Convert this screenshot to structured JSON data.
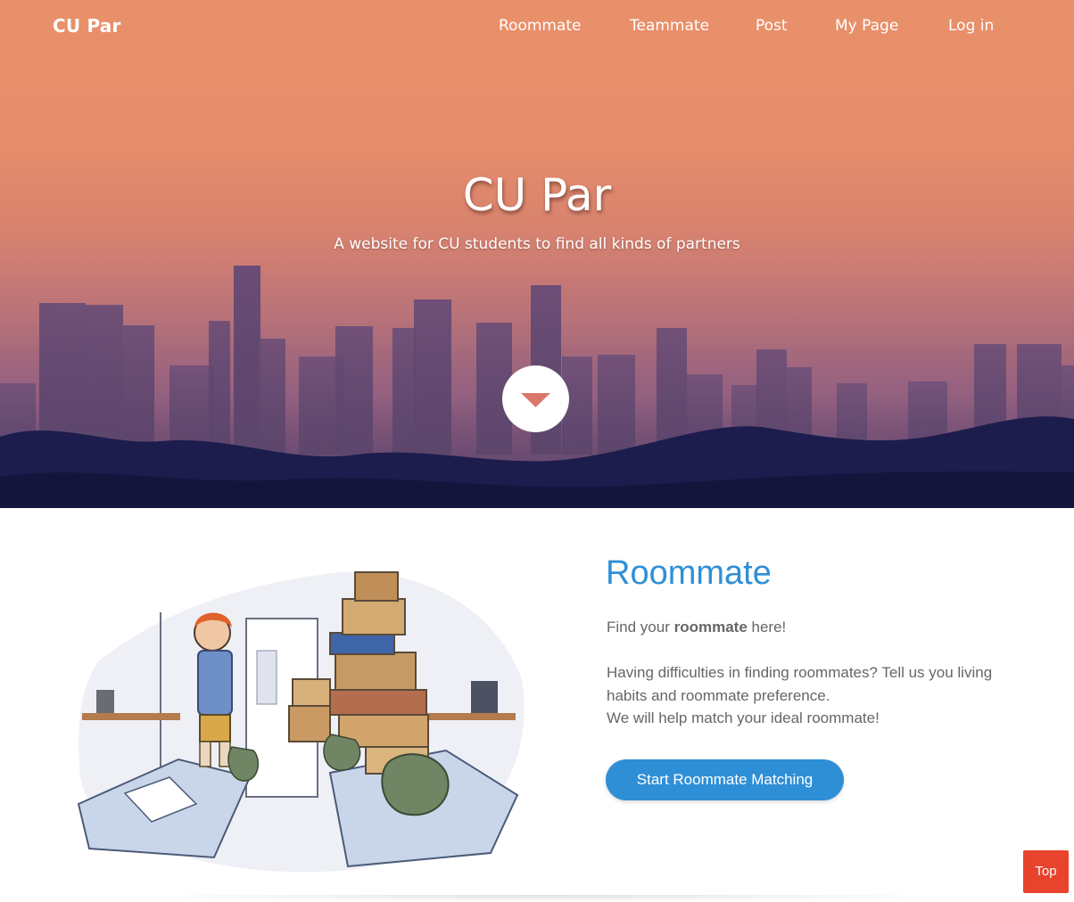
{
  "brand": "CU Par",
  "nav": {
    "items": [
      {
        "label": "Roommate"
      },
      {
        "label": "Teammate"
      },
      {
        "label": "Post"
      },
      {
        "label": "My Page"
      },
      {
        "label": "Log in"
      }
    ]
  },
  "hero": {
    "title": "CU Par",
    "subtitle": "A website for CU students to find all kinds of partners",
    "scroll_icon": "caret-down-icon"
  },
  "feature": {
    "heading": "Roommate",
    "intro_prefix": "Find your ",
    "intro_bold": "roommate",
    "intro_suffix": " here!",
    "description_lines": [
      "Having difficulties in finding roommates? Tell us you living",
      "habits and roommate preference.",
      "We will help match your ideal roommate!"
    ],
    "cta_label": "Start Roommate Matching"
  },
  "top_button": "Top",
  "colors": {
    "accent_blue": "#2f8fd6",
    "top_button_red": "#e8432d",
    "body_text": "#666666",
    "caret": "#d9776b"
  }
}
